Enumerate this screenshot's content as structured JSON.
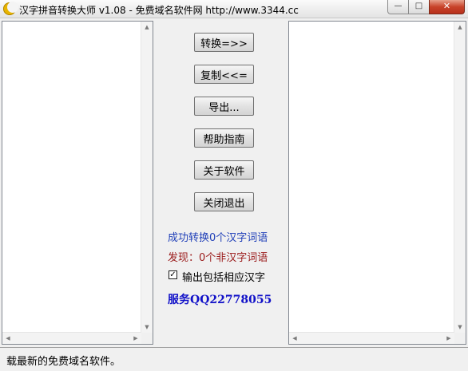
{
  "window": {
    "title": "汉字拼音转换大师 v1.08 - 免费域名软件网 http://www.3344.cc",
    "min_glyph": "—",
    "max_glyph": "□",
    "close_glyph": "✕"
  },
  "buttons": {
    "convert": "转换=>>",
    "copy": "复制<<=",
    "export": "导出...",
    "help": "帮助指南",
    "about": "关于软件",
    "exit": "关闭退出"
  },
  "stats": {
    "success": "成功转换0个汉字词语",
    "found": "发现：0个非汉字词语"
  },
  "checkbox": {
    "label": "输出包括相应汉字",
    "checked": true,
    "mark": "✓"
  },
  "service": "服务QQ22778055",
  "status_bar": "载最新的免费域名软件。",
  "icons": {
    "app": "crescent-moon-icon",
    "scroll_up": "▲",
    "scroll_down": "▼",
    "scroll_left": "◀",
    "scroll_right": "▶"
  },
  "colors": {
    "stat_success": "#1f3fb8",
    "stat_found": "#9a1a1a",
    "service": "#1010c8"
  }
}
